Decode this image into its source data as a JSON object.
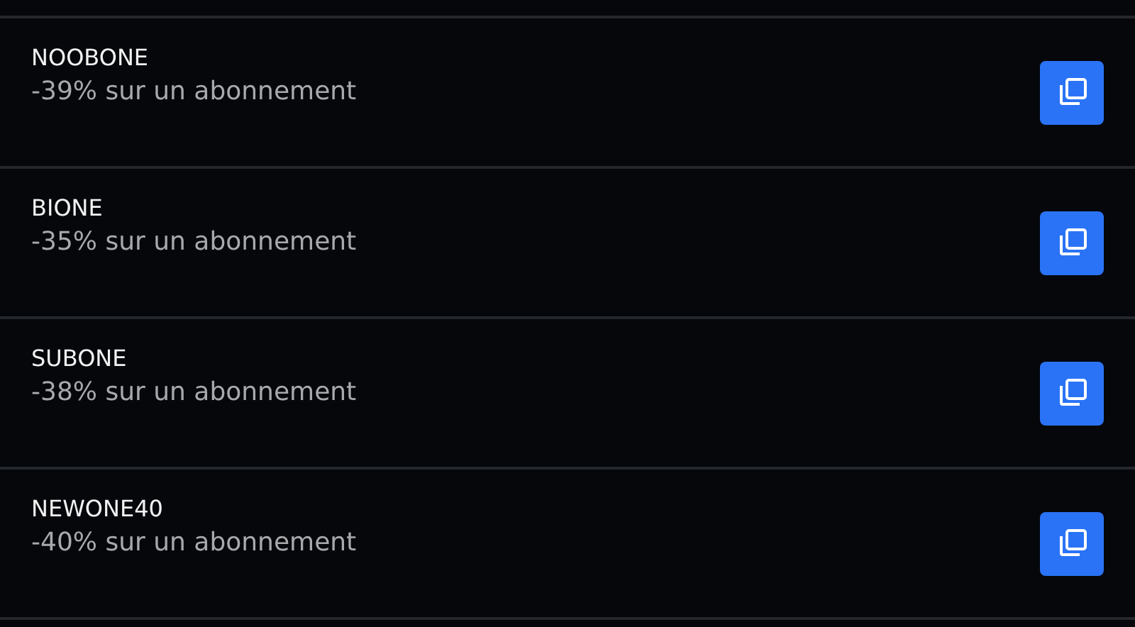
{
  "coupons": [
    {
      "code": "NOOBONE",
      "description": "-39% sur un abonnement"
    },
    {
      "code": "BIONE",
      "description": "-35% sur un abonnement"
    },
    {
      "code": "SUBONE",
      "description": "-38% sur un abonnement"
    },
    {
      "code": "NEWONE40",
      "description": "-40% sur un abonnement"
    }
  ]
}
